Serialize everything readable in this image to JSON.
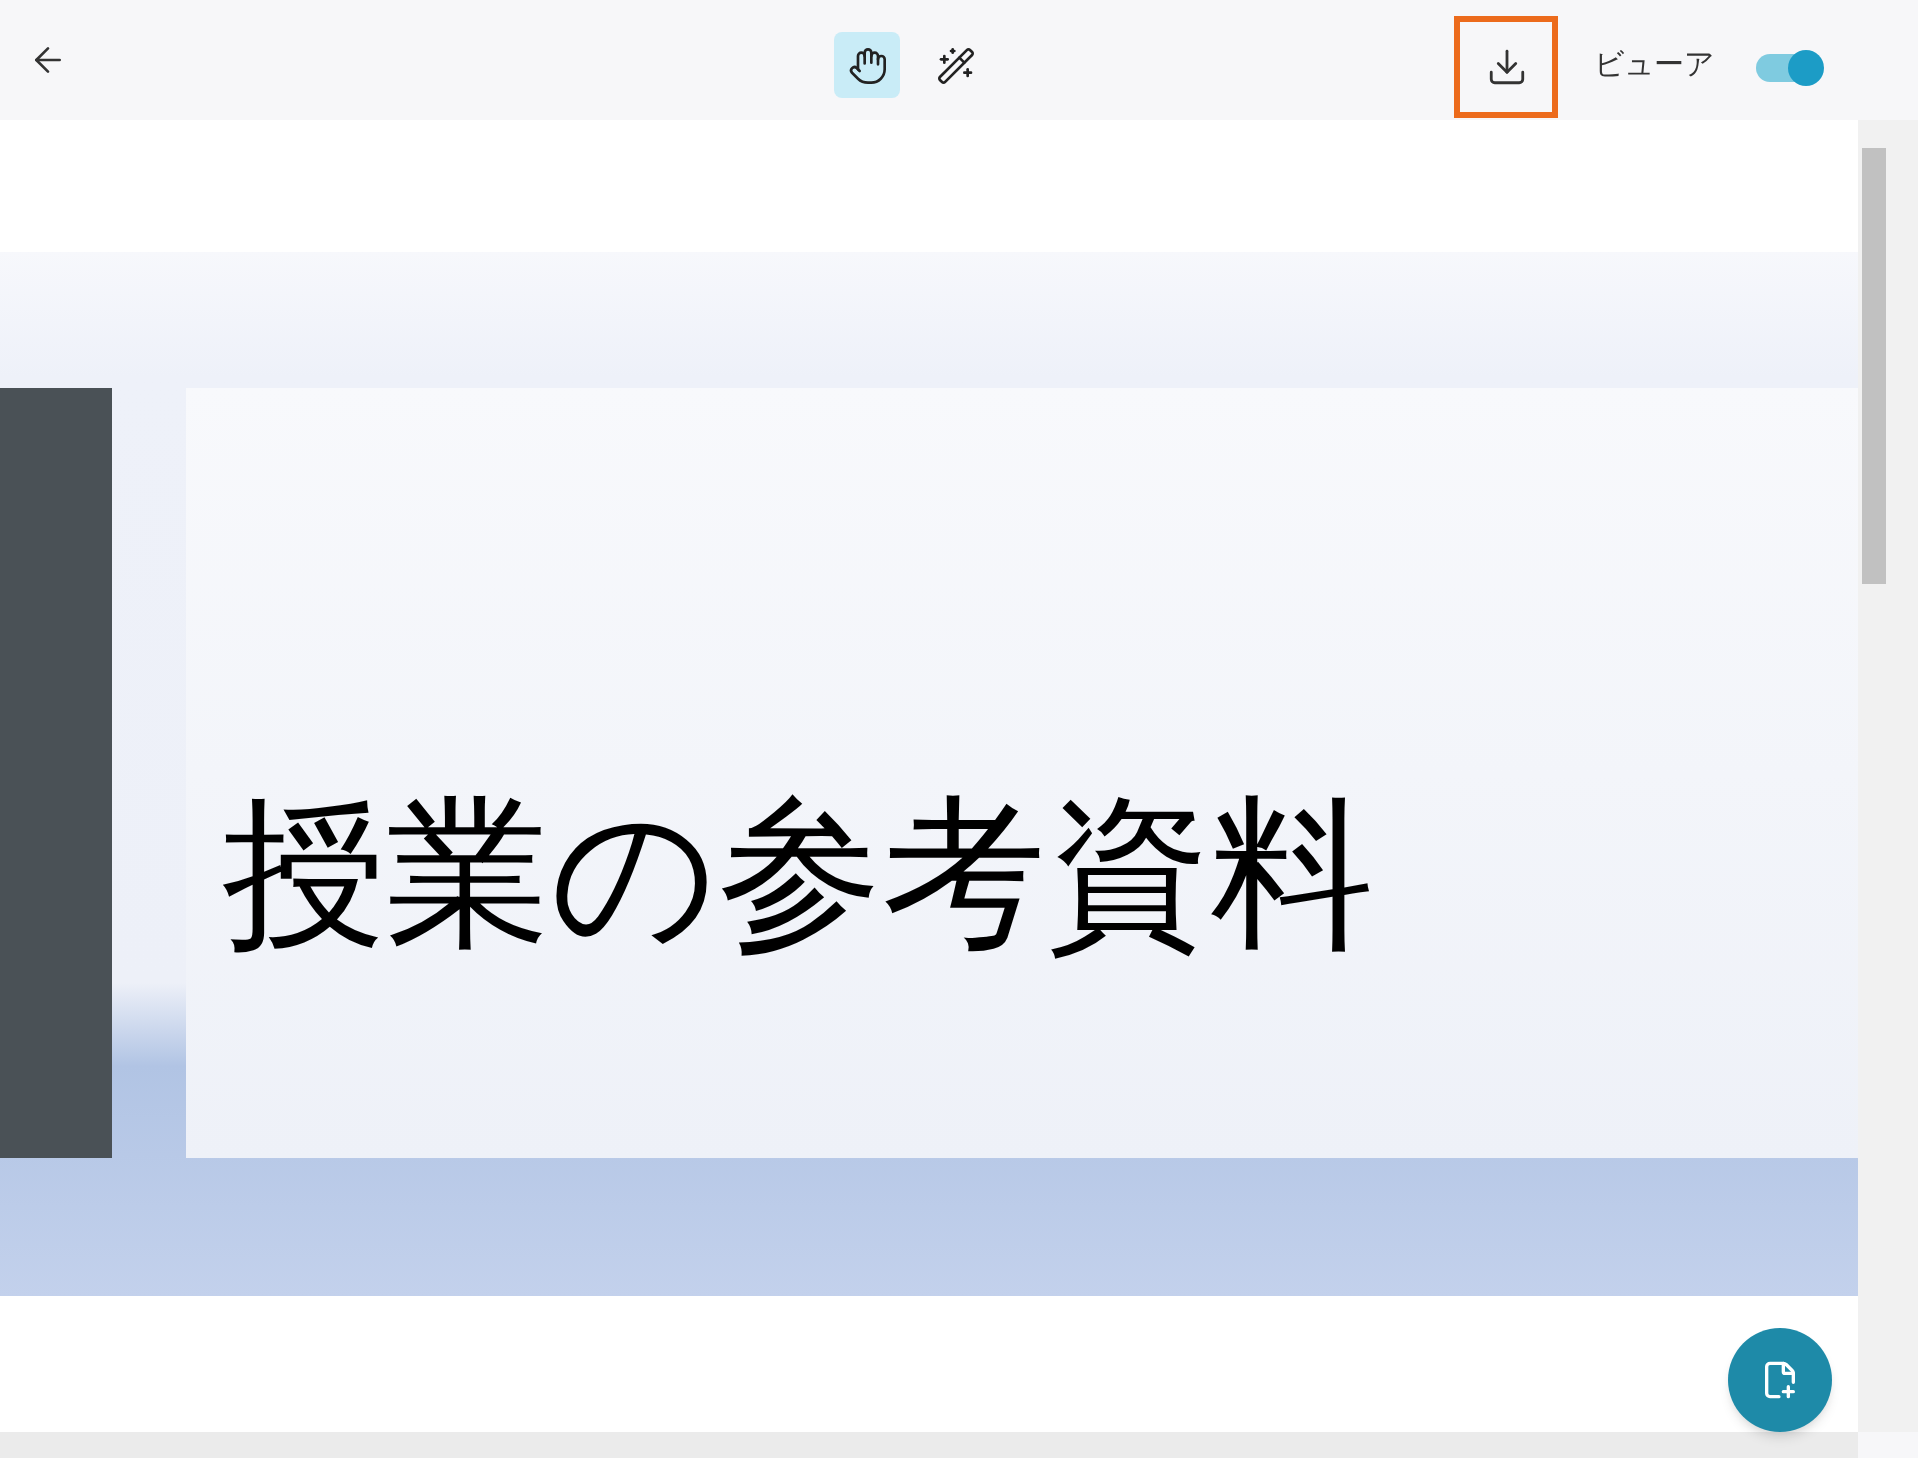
{
  "toolbar": {
    "tools": [
      {
        "kind": "hand",
        "selected": true
      },
      {
        "kind": "wand",
        "selected": false
      }
    ],
    "download": {
      "highlighted": true
    },
    "viewer_toggle": {
      "label": "ビューア",
      "on": true
    }
  },
  "slide": {
    "title": "授業の参考資料"
  }
}
